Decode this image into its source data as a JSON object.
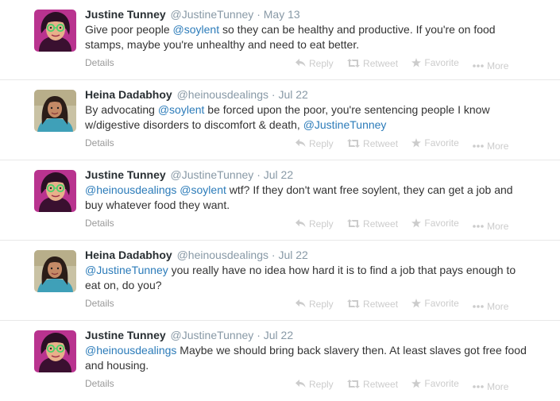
{
  "tweets": [
    {
      "name": "Justine Tunney",
      "handle": "@JustineTunney",
      "time": "May 13",
      "avatar": "justine",
      "segments": [
        {
          "t": "Give poor people ",
          "m": false
        },
        {
          "t": "@soylent",
          "m": true
        },
        {
          "t": " so they can be healthy and productive. If you're on food stamps, maybe you're unhealthy and need to eat better.",
          "m": false
        }
      ]
    },
    {
      "name": "Heina Dadabhoy",
      "handle": "@heinousdealings",
      "time": "Jul 22",
      "avatar": "heina",
      "segments": [
        {
          "t": "By advocating ",
          "m": false
        },
        {
          "t": "@soylent",
          "m": true
        },
        {
          "t": " be forced upon the poor, you're sentencing people I know w/digestive disorders to discomfort & death, ",
          "m": false
        },
        {
          "t": "@JustineTunney",
          "m": true
        }
      ]
    },
    {
      "name": "Justine Tunney",
      "handle": "@JustineTunney",
      "time": "Jul 22",
      "avatar": "justine",
      "segments": [
        {
          "t": "@heinousdealings",
          "m": true
        },
        {
          "t": " ",
          "m": false
        },
        {
          "t": "@soylent",
          "m": true
        },
        {
          "t": " wtf? If they don't want free soylent, they can get a job and buy whatever food they want.",
          "m": false
        }
      ]
    },
    {
      "name": "Heina Dadabhoy",
      "handle": "@heinousdealings",
      "time": "Jul 22",
      "avatar": "heina",
      "segments": [
        {
          "t": "@JustineTunney",
          "m": true
        },
        {
          "t": " you really have no idea how hard it is to find a job that pays enough to eat on, do you?",
          "m": false
        }
      ]
    },
    {
      "name": "Justine Tunney",
      "handle": "@JustineTunney",
      "time": "Jul 22",
      "avatar": "justine",
      "segments": [
        {
          "t": "@heinousdealings",
          "m": true
        },
        {
          "t": " Maybe we should bring back slavery then. At least slaves got free food and housing.",
          "m": false
        }
      ]
    }
  ],
  "labels": {
    "details": "Details",
    "reply": "Reply",
    "retweet": "Retweet",
    "favorite": "Favorite",
    "more": "More",
    "separator": "·"
  },
  "colors": {
    "mention": "#2b7bb9",
    "name": "#292f33",
    "muted": "#8899a6",
    "action": "#cccccc"
  }
}
